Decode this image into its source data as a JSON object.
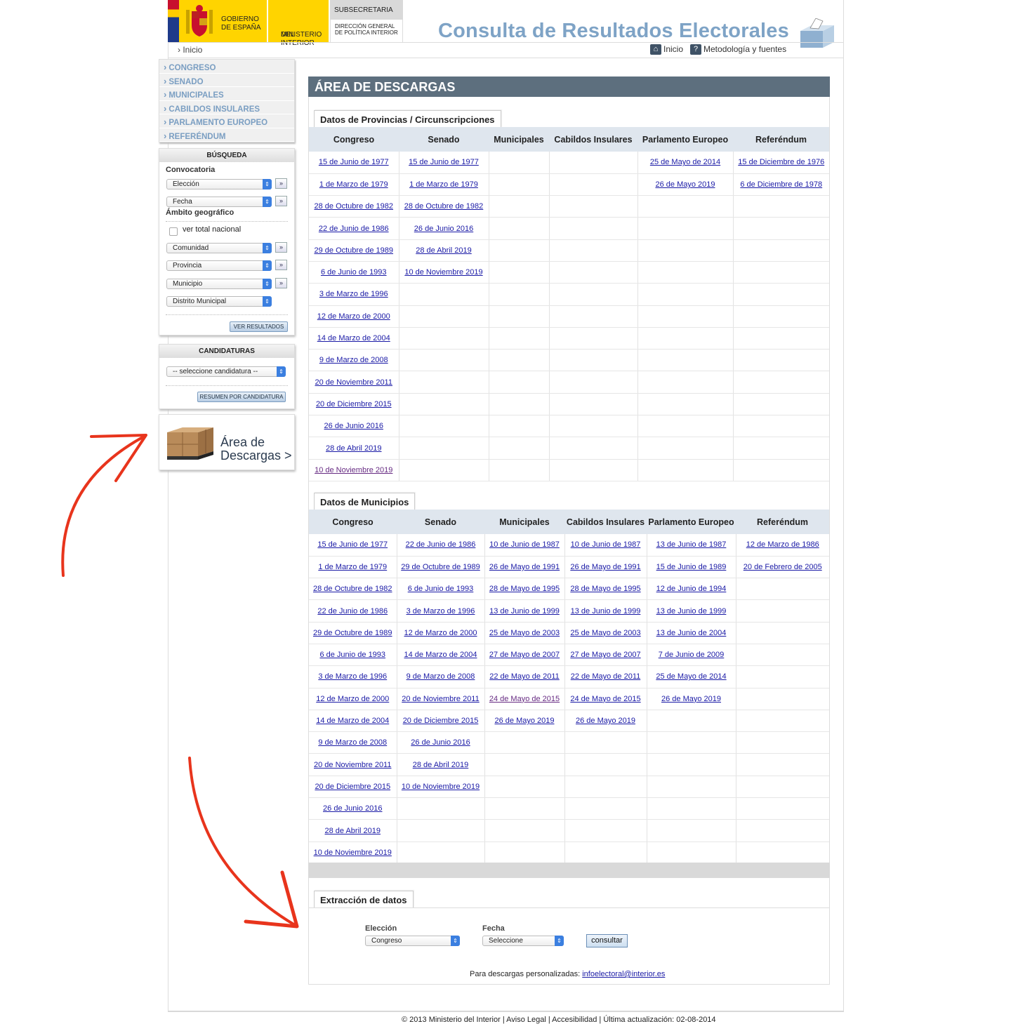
{
  "header": {
    "gov_line1": "GOBIERNO",
    "gov_line2": "DE ESPAÑA",
    "min_line1": "MINISTERIO",
    "min_line2": "DEL INTERIOR",
    "sub": "SUBSECRETARIA",
    "dg_line1": "DIRECCIÓN GENERAL",
    "dg_line2": "DE POLÍTICA INTERIOR",
    "app_title": "Consulta de Resultados Electorales",
    "breadcrumb": "› Inicio",
    "home_link": "Inicio",
    "method_link": "Metodología y fuentes"
  },
  "side_menu": [
    "CONGRESO",
    "SENADO",
    "MUNICIPALES",
    "CABILDOS INSULARES",
    "PARLAMENTO EUROPEO",
    "REFERÉNDUM"
  ],
  "search": {
    "title": "BÚSQUEDA",
    "convocatoria": "Convocatoria",
    "eleccion": "Elección",
    "fecha": "Fecha",
    "ambito": "Ámbito geográfico",
    "ver_total": "ver total nacional",
    "comunidad": "Comunidad",
    "provincia": "Provincia",
    "municipio": "Municipio",
    "distrito": "Distrito Municipal",
    "ver_resultados": "VER RESULTADOS",
    "go": "»"
  },
  "candidaturas": {
    "title": "CANDIDATURAS",
    "select": "-- seleccione candidatura --",
    "button": "RESUMEN POR CANDIDATURA"
  },
  "downloads_box": {
    "line1": "Área de",
    "line2": "Descargas >"
  },
  "main": {
    "title": "ÁREA DE DESCARGAS",
    "provincias_tab": "Datos de Provincias / Circunscripciones",
    "municipios_tab": "Datos de Municipios",
    "extraccion_tab": "Extracción de datos"
  },
  "columns": [
    "Congreso",
    "Senado",
    "Municipales",
    "Cabildos Insulares",
    "Parlamento Europeo",
    "Referéndum"
  ],
  "provincias_rows": [
    [
      "15 de Junio de 1977",
      "15 de Junio de 1977",
      "",
      "",
      "25 de Mayo de 2014",
      "15 de Diciembre de 1976"
    ],
    [
      "1 de Marzo de 1979",
      "1 de Marzo de 1979",
      "",
      "",
      "26 de Mayo 2019",
      "6 de Diciembre de 1978"
    ],
    [
      "28 de Octubre de 1982",
      "28 de Octubre de 1982",
      "",
      "",
      "",
      ""
    ],
    [
      "22 de Junio de 1986",
      "26 de Junio 2016",
      "",
      "",
      "",
      ""
    ],
    [
      "29 de Octubre de 1989",
      "28 de Abril 2019",
      "",
      "",
      "",
      ""
    ],
    [
      "6 de Junio de 1993",
      "10 de Noviembre 2019",
      "",
      "",
      "",
      ""
    ],
    [
      "3 de Marzo de 1996",
      "",
      "",
      "",
      "",
      ""
    ],
    [
      "12 de Marzo de 2000",
      "",
      "",
      "",
      "",
      ""
    ],
    [
      "14 de Marzo de 2004",
      "",
      "",
      "",
      "",
      ""
    ],
    [
      "9 de Marzo de 2008",
      "",
      "",
      "",
      "",
      ""
    ],
    [
      "20 de Noviembre 2011",
      "",
      "",
      "",
      "",
      ""
    ],
    [
      "20 de Diciembre 2015",
      "",
      "",
      "",
      "",
      ""
    ],
    [
      "26 de Junio 2016",
      "",
      "",
      "",
      "",
      ""
    ],
    [
      "28 de Abril 2019",
      "",
      "",
      "",
      "",
      ""
    ],
    [
      "10 de Noviembre 2019",
      "",
      "",
      "",
      "",
      ""
    ]
  ],
  "municipios_rows": [
    [
      "15 de Junio de 1977",
      "22 de Junio de 1986",
      "10 de Junio de 1987",
      "10 de Junio de 1987",
      "13 de Junio de 1987",
      "12 de Marzo de 1986"
    ],
    [
      "1 de Marzo de 1979",
      "29 de Octubre de 1989",
      "26 de Mayo de 1991",
      "26 de Mayo de 1991",
      "15 de Junio de 1989",
      "20 de Febrero de 2005"
    ],
    [
      "28 de Octubre de 1982",
      "6 de Junio de 1993",
      "28 de Mayo de 1995",
      "28 de Mayo de 1995",
      "12 de Junio de 1994",
      ""
    ],
    [
      "22 de Junio de 1986",
      "3 de Marzo de 1996",
      "13 de Junio de 1999",
      "13 de Junio de 1999",
      "13 de Junio de 1999",
      ""
    ],
    [
      "29 de Octubre de 1989",
      "12 de Marzo de 2000",
      "25 de Mayo de 2003",
      "25 de Mayo de 2003",
      "13 de Junio de 2004",
      ""
    ],
    [
      "6 de Junio de 1993",
      "14 de Marzo de 2004",
      "27 de Mayo de 2007",
      "27 de Mayo de 2007",
      "7 de Junio de 2009",
      ""
    ],
    [
      "3 de Marzo de 1996",
      "9 de Marzo de 2008",
      "22 de Mayo de 2011",
      "22 de Mayo de 2011",
      "25 de Mayo de 2014",
      ""
    ],
    [
      "12 de Marzo de 2000",
      "20 de Noviembre 2011",
      "24 de Mayo de 2015",
      "24 de Mayo de 2015",
      "26 de Mayo 2019",
      ""
    ],
    [
      "14 de Marzo de 2004",
      "20 de Diciembre 2015",
      "26 de Mayo 2019",
      "26 de Mayo 2019",
      "",
      ""
    ],
    [
      "9 de Marzo de 2008",
      "26 de Junio 2016",
      "",
      "",
      "",
      ""
    ],
    [
      "20 de Noviembre 2011",
      "28 de Abril 2019",
      "",
      "",
      "",
      ""
    ],
    [
      "20 de Diciembre 2015",
      "10 de Noviembre 2019",
      "",
      "",
      "",
      ""
    ],
    [
      "26 de Junio 2016",
      "",
      "",
      "",
      "",
      ""
    ],
    [
      "28 de Abril 2019",
      "",
      "",
      "",
      "",
      ""
    ],
    [
      "10 de Noviembre 2019",
      "",
      "",
      "",
      "",
      ""
    ]
  ],
  "extraction": {
    "eleccion_label": "Elección",
    "eleccion_value": "Congreso",
    "fecha_label": "Fecha",
    "fecha_value": "Seleccione",
    "button": "consultar",
    "contact_text": "Para descargas personalizadas:",
    "contact_email": "infoelectoral@interior.es"
  },
  "footer": "© 2013 Ministerio del Interior  |  Aviso Legal  |  Accesibilidad  |  Última actualización: 02-08-2014",
  "colors": {
    "accent_header": "#5d6f7e",
    "title_blue": "#7ea3c6",
    "link": "#1a1aa6",
    "annotation_arrow": "#e8341c",
    "gov_yellow": "#ffd400"
  }
}
